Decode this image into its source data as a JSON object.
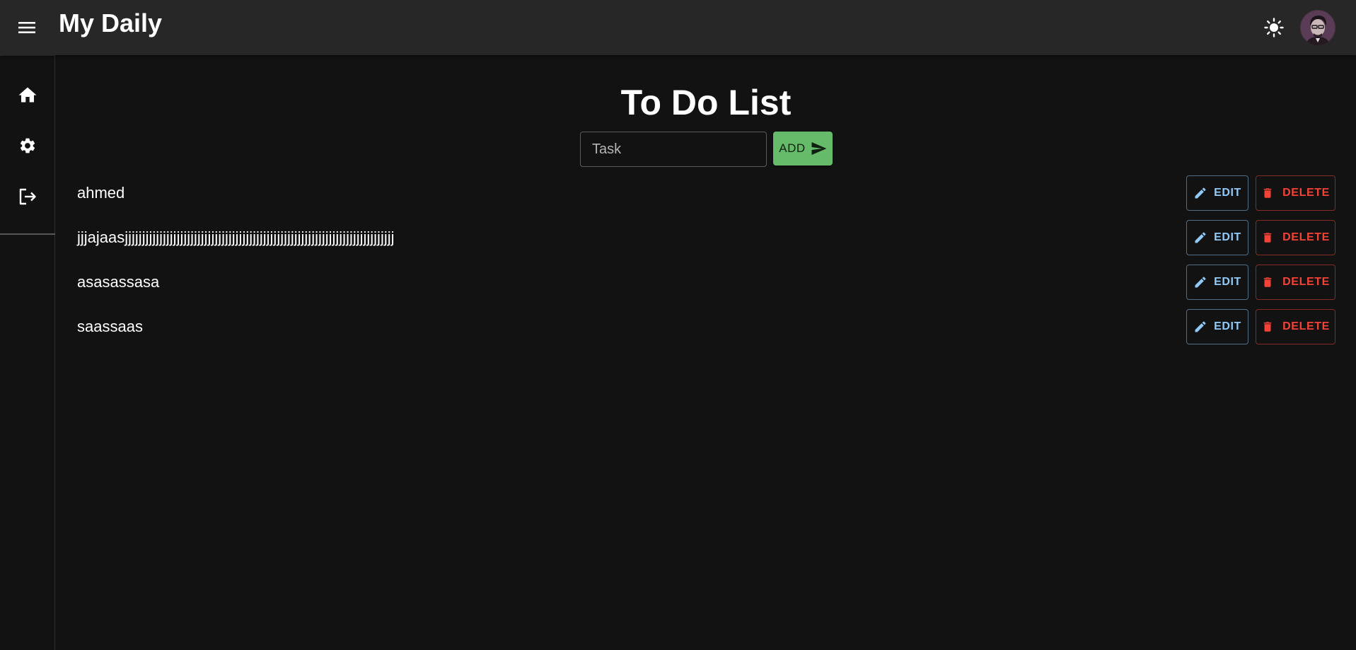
{
  "appbar": {
    "title": "My Daily",
    "menu_icon": "hamburger-menu-icon",
    "theme_icon": "sun-icon",
    "avatar_icon": "user-avatar"
  },
  "sidebar": {
    "items": [
      {
        "name": "home",
        "icon": "home-icon"
      },
      {
        "name": "settings",
        "icon": "gear-icon"
      },
      {
        "name": "logout",
        "icon": "logout-icon"
      }
    ]
  },
  "main": {
    "title": "To Do List",
    "task_input": {
      "placeholder": "Task",
      "value": ""
    },
    "add_button": {
      "label": "ADD",
      "icon": "send-icon"
    },
    "tasks": [
      {
        "text": "ahmed",
        "edit_label": "EDIT",
        "delete_label": "DELETE"
      },
      {
        "text": "jjjajaasjjjjjjjjjjjjjjjjjjjjjjjjjjjjjjjjjjjjjjjjjjjjjjjjjjjjjjjjjjjjjjjjjjjjjjjjjjjjjj",
        "edit_label": "EDIT",
        "delete_label": "DELETE"
      },
      {
        "text": "asasassasa",
        "edit_label": "EDIT",
        "delete_label": "DELETE"
      },
      {
        "text": "saassaas",
        "edit_label": "EDIT",
        "delete_label": "DELETE"
      }
    ]
  },
  "colors": {
    "background": "#121212",
    "appbar": "#272727",
    "add_button": "#66bb6a",
    "edit": "#90caf9",
    "delete": "#f44336"
  }
}
